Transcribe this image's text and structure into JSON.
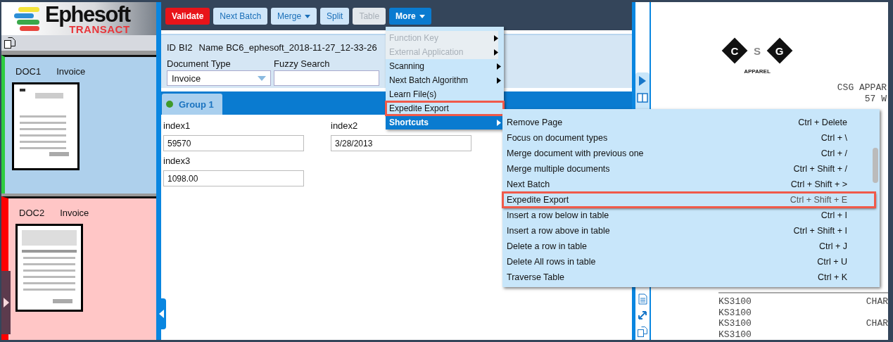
{
  "logo": {
    "name": "Ephesoft",
    "product": "TRANSACT"
  },
  "documents": [
    {
      "id": "DOC1",
      "type": "Invoice",
      "kind": "valid",
      "color": "#2ecc40"
    },
    {
      "id": "DOC2",
      "type": "Invoice",
      "kind": "invalid",
      "color": "#ff0000"
    }
  ],
  "toolbar": [
    {
      "label": "Validate",
      "kind": "primary",
      "menu": false,
      "disabled": false,
      "open": false
    },
    {
      "label": "Next Batch",
      "kind": "normal",
      "menu": false,
      "disabled": false,
      "open": false
    },
    {
      "label": "Merge",
      "kind": "normal",
      "menu": true,
      "disabled": false,
      "open": false
    },
    {
      "label": "Split",
      "kind": "normal",
      "menu": false,
      "disabled": false,
      "open": false
    },
    {
      "label": "Table",
      "kind": "normal",
      "menu": false,
      "disabled": true,
      "open": false
    },
    {
      "label": "More",
      "kind": "normal",
      "menu": true,
      "disabled": false,
      "open": true
    }
  ],
  "batch": {
    "id_label": "ID",
    "id": "BI2",
    "name_label": "Name",
    "name": "BC6_ephesoft_2018-11-27_12-33-26"
  },
  "document_type": {
    "label": "Document Type",
    "value": "Invoice"
  },
  "fuzzy_search": {
    "label": "Fuzzy Search"
  },
  "field_groups": [
    {
      "label": "Group 1",
      "selected": true
    }
  ],
  "fields": [
    {
      "label": "index1",
      "value": "59570"
    },
    {
      "label": "index2",
      "value": "3/28/2013"
    },
    {
      "label": "index3",
      "value": "1098.00"
    }
  ],
  "more_menu": [
    {
      "label": "Function Key",
      "disabled": true,
      "submenu": true,
      "highlighted": false,
      "selected": false
    },
    {
      "label": "External Application",
      "disabled": true,
      "submenu": true,
      "highlighted": false,
      "selected": false
    },
    {
      "label": "Scanning",
      "disabled": false,
      "submenu": true,
      "highlighted": false,
      "selected": false
    },
    {
      "label": "Next Batch Algorithm",
      "disabled": false,
      "submenu": true,
      "highlighted": false,
      "selected": false
    },
    {
      "label": "Learn File(s)",
      "disabled": false,
      "submenu": false,
      "highlighted": false,
      "selected": false
    },
    {
      "label": "Expedite Export",
      "disabled": false,
      "submenu": false,
      "highlighted": true,
      "selected": false
    },
    {
      "label": "Shortcuts",
      "disabled": false,
      "submenu": true,
      "highlighted": false,
      "selected": true
    }
  ],
  "shortcuts_menu": [
    {
      "label": "Remove Page",
      "keys": "Ctrl + Delete",
      "highlighted": false
    },
    {
      "label": "Focus on document types",
      "keys": "Ctrl + \\",
      "highlighted": false
    },
    {
      "label": "Merge document with previous one",
      "keys": "Ctrl + /",
      "highlighted": false
    },
    {
      "label": "Merge multiple documents",
      "keys": "Ctrl + Shift + /",
      "highlighted": false
    },
    {
      "label": "Next Batch",
      "keys": "Ctrl + Shift + >",
      "highlighted": false
    },
    {
      "label": "Expedite Export",
      "keys": "Ctrl + Shift + E",
      "highlighted": true
    },
    {
      "label": "Insert a row below in table",
      "keys": "Ctrl + I",
      "highlighted": false
    },
    {
      "label": "Insert a row above in table",
      "keys": "Ctrl + Shift + I",
      "highlighted": false
    },
    {
      "label": "Delete a row in table",
      "keys": "Ctrl + J",
      "highlighted": false
    },
    {
      "label": "Delete All rows in table",
      "keys": "Ctrl + U",
      "highlighted": false
    },
    {
      "label": "Traverse Table",
      "keys": "Ctrl + K",
      "highlighted": false
    }
  ],
  "preview": {
    "logo_letters": [
      "C",
      "S",
      "G"
    ],
    "logo_caption": "APPAREL",
    "header_lines": [
      "CSG APPAR",
      "57 W"
    ],
    "rows": [
      {
        "code": "KS3100",
        "column_2": "CHAR"
      },
      {
        "code": "KS3100"
      },
      {
        "code": "KS3100",
        "column_2": "CHAR"
      },
      {
        "code": "KS3100"
      }
    ]
  }
}
